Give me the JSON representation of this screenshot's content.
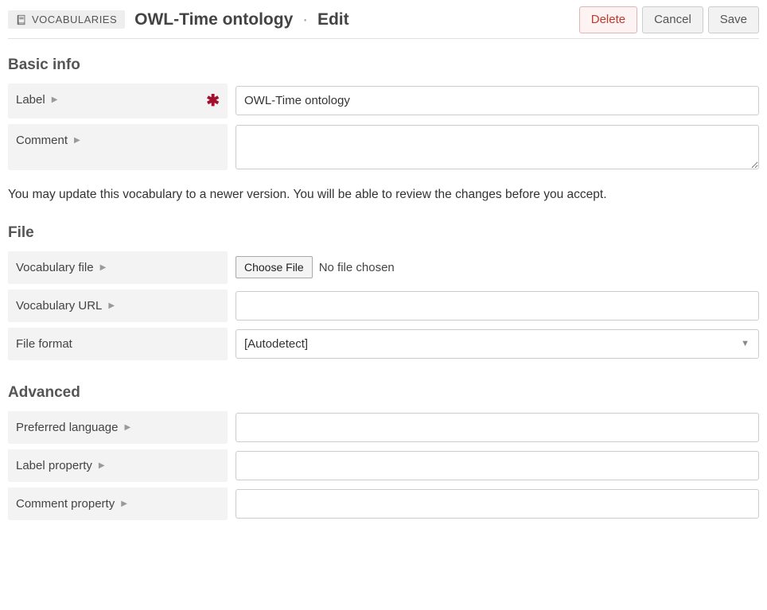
{
  "breadcrumb": {
    "label": "VOCABULARIES"
  },
  "title": {
    "name": "OWL-Time ontology",
    "mode": "Edit"
  },
  "buttons": {
    "delete": "Delete",
    "cancel": "Cancel",
    "save": "Save"
  },
  "sections": {
    "basic": {
      "heading": "Basic info"
    },
    "file": {
      "heading": "File"
    },
    "advanced": {
      "heading": "Advanced"
    }
  },
  "fields": {
    "label": {
      "label": "Label",
      "value": "OWL-Time ontology",
      "required": true
    },
    "comment": {
      "label": "Comment",
      "value": ""
    },
    "vocab_file": {
      "label": "Vocabulary file",
      "choose_btn": "Choose File",
      "status": "No file chosen"
    },
    "vocab_url": {
      "label": "Vocabulary URL",
      "value": ""
    },
    "file_format": {
      "label": "File format",
      "value": "[Autodetect]"
    },
    "pref_lang": {
      "label": "Preferred language",
      "value": ""
    },
    "label_prop": {
      "label": "Label property",
      "value": ""
    },
    "comment_prop": {
      "label": "Comment property",
      "value": ""
    }
  },
  "info_text": "You may update this vocabulary to a newer version. You will be able to review the changes before you accept."
}
